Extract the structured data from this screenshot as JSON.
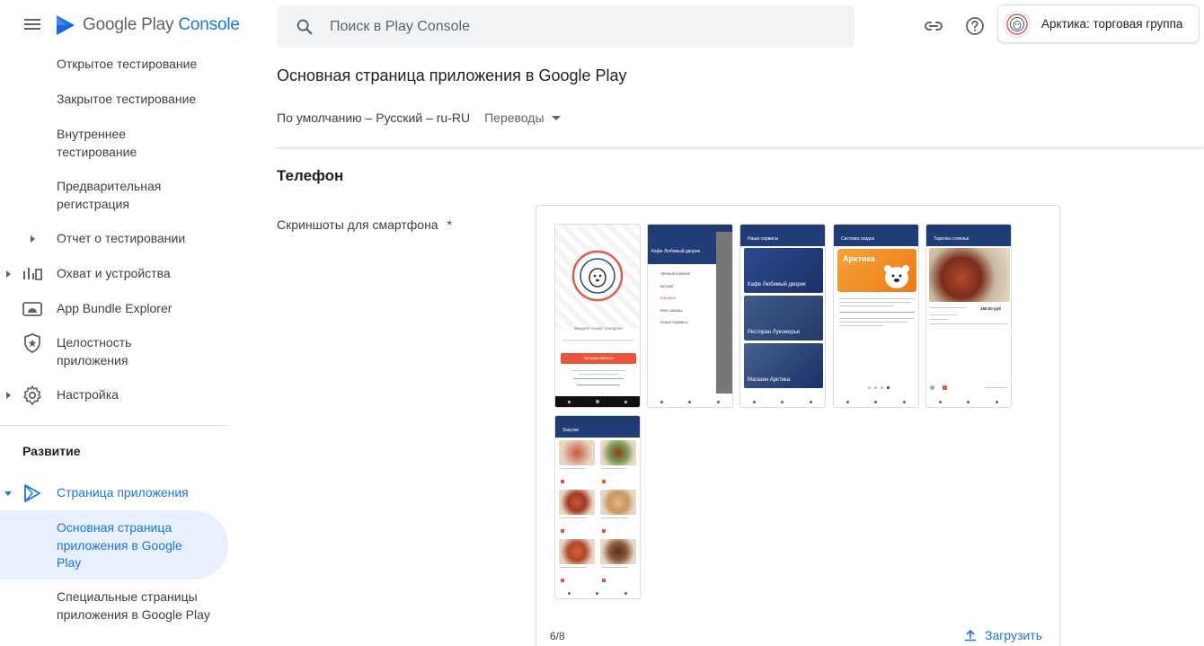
{
  "header": {
    "logo_google": "Google Play",
    "logo_console": "Console",
    "search_placeholder": "Поиск в Play Console",
    "account_name": "Арктика: торговая группа"
  },
  "sidebar": {
    "items": [
      {
        "label": "Открытое тестирование"
      },
      {
        "label": "Закрытое тестирование"
      },
      {
        "label": "Внутреннее тестирование"
      },
      {
        "label": "Предварительная регистрация"
      },
      {
        "label": "Отчет о тестировании"
      },
      {
        "label": "Охват и устройства"
      },
      {
        "label": "App Bundle Explorer"
      },
      {
        "label": "Целостность приложения"
      },
      {
        "label": "Настройка"
      }
    ],
    "section_title": "Развитие",
    "store_presence": "Страница приложения",
    "main_listing": "Основная страница приложения в Google Play",
    "custom_listings": "Специальные страницы приложения в Google Play"
  },
  "main": {
    "page_title": "Основная страница приложения в Google Play",
    "language": "По умолчанию – Русский – ru-RU",
    "translations": "Переводы",
    "section_phone": "Телефон",
    "field_label": "Скриншоты для смартфона",
    "required_mark": "*",
    "counter": "6/8",
    "upload_label": "Загрузить"
  },
  "screenshots": {
    "shot1": {
      "phone_hint": "Введите номер телефона",
      "button": "Авторизоваться"
    },
    "shot2": {
      "title": "Кафе Любимый дворик",
      "menu": [
        "Личный кабинет",
        "Бутики",
        "Корзина",
        "Мои заказы",
        "Наши сервисы"
      ]
    },
    "shot3": {
      "title": "Наши сервисы",
      "tiles": [
        "Кафе Любимый дворик",
        "Ресторан Лукоморье",
        "Магазин Арктика"
      ]
    },
    "shot4": {
      "title": "Система скидок",
      "card_title": "Арктика"
    },
    "shot5": {
      "title": "Тарелка соленья",
      "price": "190,00 руб"
    },
    "shot6": {
      "title": "Закуски"
    }
  },
  "colors": {
    "accent": "#1a73e8",
    "app_bar": "#203d78",
    "orange": "#f08a1c",
    "red_button": "#e8553b"
  }
}
